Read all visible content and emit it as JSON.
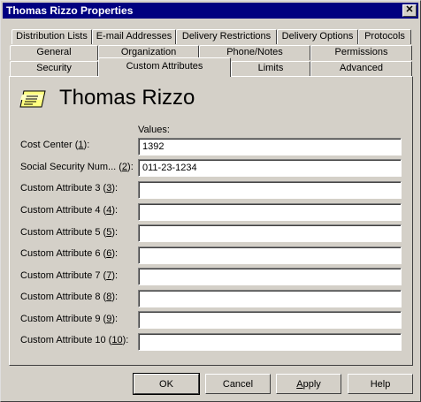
{
  "window": {
    "title": "Thomas Rizzo Properties",
    "close_glyph": "✕"
  },
  "tabs": {
    "row1": [
      "Distribution Lists",
      "E-mail Addresses",
      "Delivery Restrictions",
      "Delivery Options",
      "Protocols"
    ],
    "row2": [
      "General",
      "Organization",
      "Phone/Notes",
      "Permissions"
    ],
    "row3": [
      "Security",
      "Custom Attributes",
      "Limits",
      "Advanced"
    ],
    "active": "Custom Attributes"
  },
  "header": {
    "icon": "user-card-icon",
    "user_name": "Thomas Rizzo"
  },
  "form": {
    "values_heading": "Values:",
    "rows": [
      {
        "label_pre": "Cost Center (",
        "key": "1",
        "label_post": "):",
        "value": "1392"
      },
      {
        "label_pre": "Social Security Num... (",
        "key": "2",
        "label_post": "):",
        "value": "011-23-1234"
      },
      {
        "label_pre": "Custom Attribute 3 (",
        "key": "3",
        "label_post": "):",
        "value": ""
      },
      {
        "label_pre": "Custom Attribute 4 (",
        "key": "4",
        "label_post": "):",
        "value": ""
      },
      {
        "label_pre": "Custom Attribute 5 (",
        "key": "5",
        "label_post": "):",
        "value": ""
      },
      {
        "label_pre": "Custom Attribute 6 (",
        "key": "6",
        "label_post": "):",
        "value": ""
      },
      {
        "label_pre": "Custom Attribute 7 (",
        "key": "7",
        "label_post": "):",
        "value": ""
      },
      {
        "label_pre": "Custom Attribute 8 (",
        "key": "8",
        "label_post": "):",
        "value": ""
      },
      {
        "label_pre": "Custom Attribute 9 (",
        "key": "9",
        "label_post": "):",
        "value": ""
      },
      {
        "label_pre": "Custom Attribute 10 (",
        "key": "10",
        "label_post": "):",
        "value": ""
      }
    ]
  },
  "buttons": {
    "ok": "OK",
    "cancel": "Cancel",
    "apply_pre": "",
    "apply_key": "A",
    "apply_post": "pply",
    "help": "Help"
  }
}
